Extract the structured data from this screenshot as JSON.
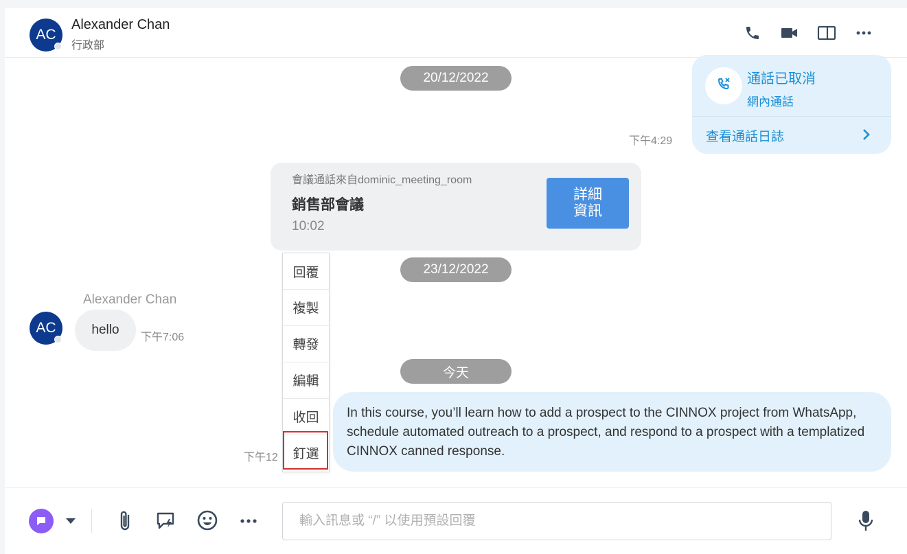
{
  "header": {
    "avatar_initials": "AC",
    "contact_name": "Alexander Chan",
    "department": "行政部",
    "icons": [
      "phone-icon",
      "video-icon",
      "side-panel-icon",
      "more-icon"
    ]
  },
  "messages": {
    "date_1": "20/12/2022",
    "call_card": {
      "title": "通話已取消",
      "subtitle": "網內通話",
      "log_link": "查看通話日誌",
      "time": "下午4:29"
    },
    "meeting_card": {
      "from": "會議通話來自dominic_meeting_room",
      "title": "銷售部會議",
      "time": "10:02",
      "details_line1": "詳細",
      "details_line2": "資訊"
    },
    "date_2": "23/12/2022",
    "incoming": {
      "sender": "Alexander Chan",
      "avatar_initials": "AC",
      "text": "hello",
      "time": "下午7:06"
    },
    "date_3": "今天",
    "outgoing": {
      "text": "In this course, you’ll learn how to add a prospect to the CINNOX project from WhatsApp, schedule automated outreach to a prospect, and respond to a prospect with a templatized CINNOX canned response.",
      "time_partial": "下午12"
    }
  },
  "context_menu": {
    "items": [
      "回覆",
      "複製",
      "轉發",
      "編輯",
      "收回",
      "釘選"
    ],
    "highlighted": "釘選"
  },
  "composer": {
    "placeholder": "輸入訊息或 “/” 以使用預設回覆",
    "icons": [
      "channel-icon",
      "dropdown-icon",
      "attach-icon",
      "quick-reply-icon",
      "emoji-icon",
      "more-icon",
      "mic-icon"
    ]
  },
  "colors": {
    "accent_blue": "#1a8fd6",
    "avatar_navy": "#0d3a8e",
    "button_blue": "#4a90e2",
    "channel_purple": "#8b5cf6",
    "highlight_red": "#d32f2f"
  }
}
